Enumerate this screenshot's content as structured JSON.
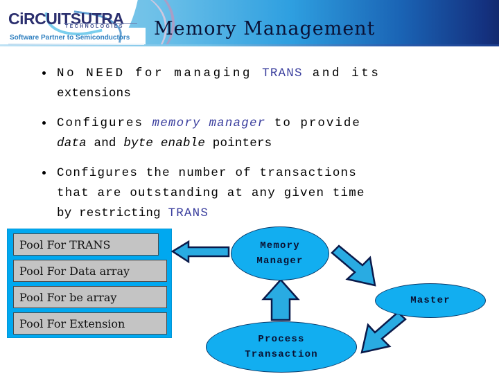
{
  "header": {
    "title": "Memory Management",
    "logo": {
      "word1": "CiRCUIT",
      "word2": "SUTRA",
      "sub": "TECHNOLOGIES",
      "tagline": "Software Partner to Semiconductors"
    },
    "colors": {
      "band_light": "#8fcdeb",
      "band_dark": "#14317f",
      "title_text": "#0a1236",
      "logo_text": "#2b2f6e",
      "tagline_text": "#2f7fbf"
    }
  },
  "bullets": [
    {
      "id": "bullet-1",
      "parts": [
        {
          "text": "No  NEED  for  managing  ",
          "style": "plain"
        },
        {
          "text": "TRANS",
          "style": "accent"
        },
        {
          "text": "  and  its",
          "style": "plain"
        },
        {
          "text": "extensions",
          "style": "plain-line2"
        }
      ],
      "plain_text": "No NEED for managing TRANS and its extensions"
    },
    {
      "id": "bullet-2",
      "parts": [
        {
          "text": "Configures  ",
          "style": "plain"
        },
        {
          "text": "memory manager",
          "style": "accent-italic"
        },
        {
          "text": "  to  provide",
          "style": "plain"
        },
        {
          "text": "data",
          "style": "italic"
        },
        {
          "text": " and ",
          "style": "plain"
        },
        {
          "text": "byte enable",
          "style": "italic"
        },
        {
          "text": " pointers",
          "style": "plain"
        }
      ],
      "plain_text": "Configures memory manager to provide data and byte enable pointers"
    },
    {
      "id": "bullet-3",
      "parts": [
        {
          "text": "Configures  the  number  of  transactions",
          "style": "plain"
        },
        {
          "text": "that  are  outstanding  at  any  given  time",
          "style": "plain"
        },
        {
          "text": "by restricting ",
          "style": "plain"
        },
        {
          "text": "TRANS",
          "style": "accent"
        }
      ],
      "plain_text": "Configures the number of transactions that are outstanding at any given time by restricting TRANS"
    }
  ],
  "bullet_text": {
    "b1_l1_a": "No  NEED  for  managing  ",
    "b1_l1_b": "TRANS",
    "b1_l1_c": "  and  its",
    "b1_l2": "extensions",
    "b2_l1_a": "Configures  ",
    "b2_l1_b": "memory manager",
    "b2_l1_c": "  to  provide",
    "b2_l2_a": "data",
    "b2_l2_b": " and ",
    "b2_l2_c": "byte enable",
    "b2_l2_d": " pointers",
    "b3_l1": "Configures  the  number  of  transactions",
    "b3_l2": "that  are  outstanding  at  any  given  time",
    "b3_l3_a": "by restricting ",
    "b3_l3_b": "TRANS"
  },
  "diagram": {
    "pools": [
      {
        "label": "Pool For TRANS"
      },
      {
        "label": "Pool For Data array"
      },
      {
        "label": "Pool For be array"
      },
      {
        "label": "Pool For Extension"
      }
    ],
    "nodes": {
      "memory_manager_line1": "Memory",
      "memory_manager_line2": "Manager",
      "master": "Master",
      "process_line1": "Process",
      "process_line2": "Transaction"
    },
    "colors": {
      "pool_container": "#00a8f0",
      "pool_fill": "#c4c4c4",
      "pool_border": "#4a4a4a",
      "ellipse_fill": "#12aef0",
      "ellipse_border": "#0a3a6a",
      "arrow_fill": "#29abe2",
      "arrow_border": "#0a1a4a"
    },
    "arrows": [
      {
        "name": "mm-to-pools",
        "direction": "left"
      },
      {
        "name": "mm-to-master",
        "direction": "down-right"
      },
      {
        "name": "master-to-process",
        "direction": "down-left"
      },
      {
        "name": "process-to-mm",
        "direction": "up"
      }
    ]
  }
}
